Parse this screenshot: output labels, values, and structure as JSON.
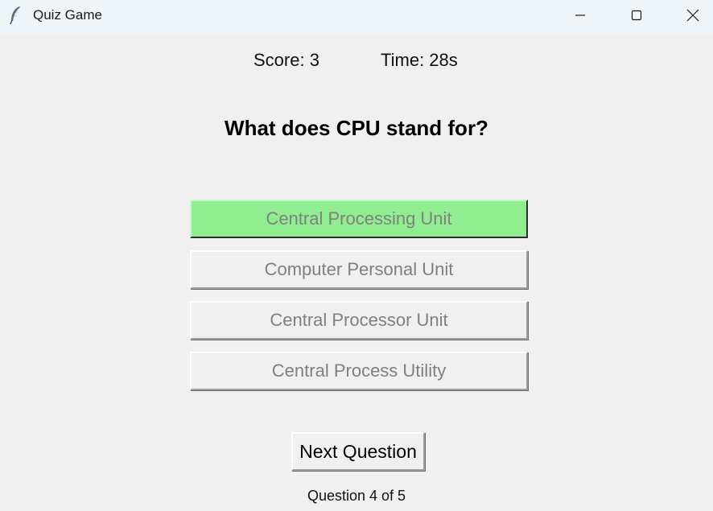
{
  "window": {
    "title": "Quiz Game",
    "icon": "feather-icon"
  },
  "status": {
    "score_label": "Score: 3",
    "time_label": "Time: 28s"
  },
  "question": {
    "text": "What does CPU stand for?"
  },
  "options": [
    {
      "label": "Central Processing Unit",
      "state": "correct"
    },
    {
      "label": "Computer Personal Unit",
      "state": "disabled"
    },
    {
      "label": "Central Processor Unit",
      "state": "disabled"
    },
    {
      "label": "Central Process Utility",
      "state": "disabled"
    }
  ],
  "controls": {
    "next_label": "Next Question"
  },
  "progress": {
    "label": "Question 4 of 5"
  },
  "colors": {
    "correct_highlight": "#90ee90",
    "window_bg": "#f0f0f0",
    "titlebar_bg": "#eff4f9",
    "disabled_text": "#808080"
  }
}
